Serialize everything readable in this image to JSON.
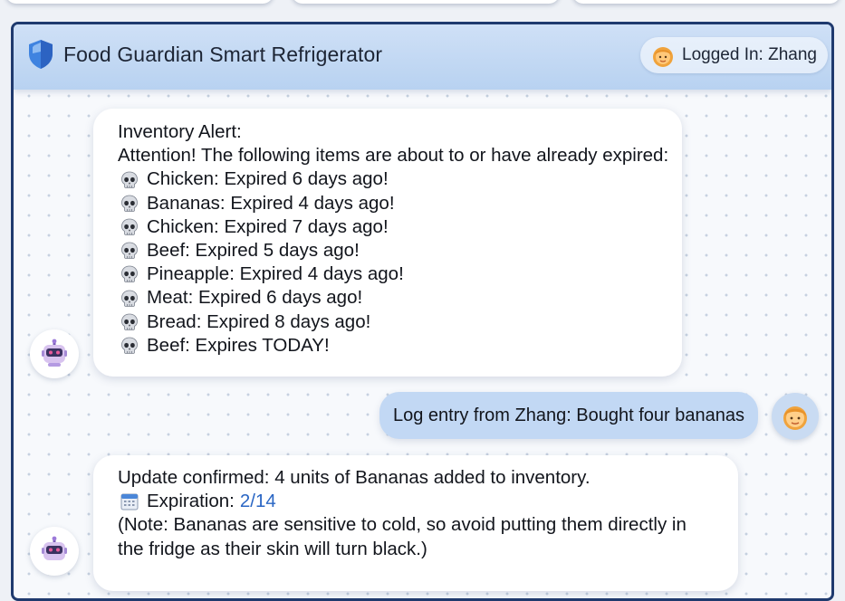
{
  "app": {
    "title": "Food Guardian Smart Refrigerator"
  },
  "user": {
    "logged_in_label": "Logged In: Zhang"
  },
  "messages": [
    {
      "sender": "bot",
      "title": "Inventory Alert:",
      "intro": "Attention! The following items are about to or have already expired:",
      "items": [
        "Chicken: Expired 6 days ago!",
        "Bananas: Expired 4 days ago!",
        "Chicken: Expired 7 days ago!",
        "Beef: Expired 5 days ago!",
        "Pineapple: Expired 4 days ago!",
        "Meat: Expired 6 days ago!",
        "Bread: Expired 8 days ago!",
        "Beef: Expires TODAY!"
      ],
      "item_icon": "skull-icon"
    },
    {
      "sender": "user",
      "text": "Log entry from Zhang: Bought four bananas"
    },
    {
      "sender": "bot",
      "confirmation": "Update confirmed: 4 units of Bananas added to inventory.",
      "expiration_label": "Expiration:",
      "expiration_date": "2/14",
      "note_line1": "(Note: Bananas are sensitive to cold, so avoid putting them directly in",
      "note_line2": "the fridge as their skin will turn black.)"
    }
  ],
  "colors": {
    "header": "#b8d2f1",
    "window_border": "#1f3a6e",
    "user_bubble": "#c2d8f4",
    "link_date": "#2a66c4"
  }
}
